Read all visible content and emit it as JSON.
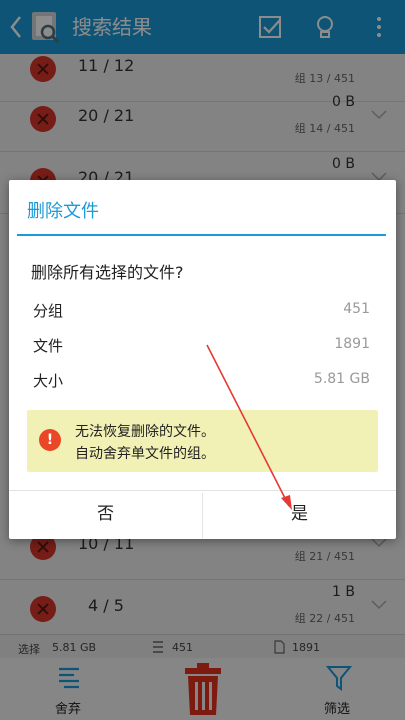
{
  "header": {
    "title": "搜索结果",
    "icons": [
      "back-chevron-icon",
      "app-icon",
      "checkbox-icon",
      "lightbulb-icon",
      "more-vertical-icon"
    ]
  },
  "list": {
    "rows": [
      {
        "count_a": "11",
        "count_b": "12",
        "size": "",
        "group": "组 13 / 451"
      },
      {
        "count_a": "20",
        "count_b": "21",
        "size": "0 B",
        "group": "组 14 / 451"
      },
      {
        "count_a": "20",
        "count_b": "21",
        "size": "0 B",
        "group": ""
      },
      {
        "count_a": "10",
        "count_b": "11",
        "size": "",
        "group": "组 21 / 451"
      },
      {
        "count_a": "4",
        "count_b": "5",
        "size": "1 B",
        "group": "组 22 / 451"
      }
    ]
  },
  "status": {
    "selected_label": "选择",
    "selected_size": "5.81 GB",
    "groups": "451",
    "files": "1891"
  },
  "bottom": {
    "discard_label": "舍弃",
    "filter_label": "筛选"
  },
  "dialog": {
    "title": "删除文件",
    "question": "删除所有选择的文件?",
    "rows": [
      {
        "label": "分组",
        "value": "451"
      },
      {
        "label": "文件",
        "value": "1891"
      },
      {
        "label": "大小",
        "value": "5.81 GB"
      }
    ],
    "warning": {
      "line1": "无法恢复删除的文件。",
      "line2": "自动舍弃单文件的组。"
    },
    "no_label": "否",
    "yes_label": "是"
  },
  "colors": {
    "accent": "#1b9ad8",
    "danger": "#d9352b",
    "warning_bg": "#f2f1b5",
    "arrow": "#e53935"
  }
}
